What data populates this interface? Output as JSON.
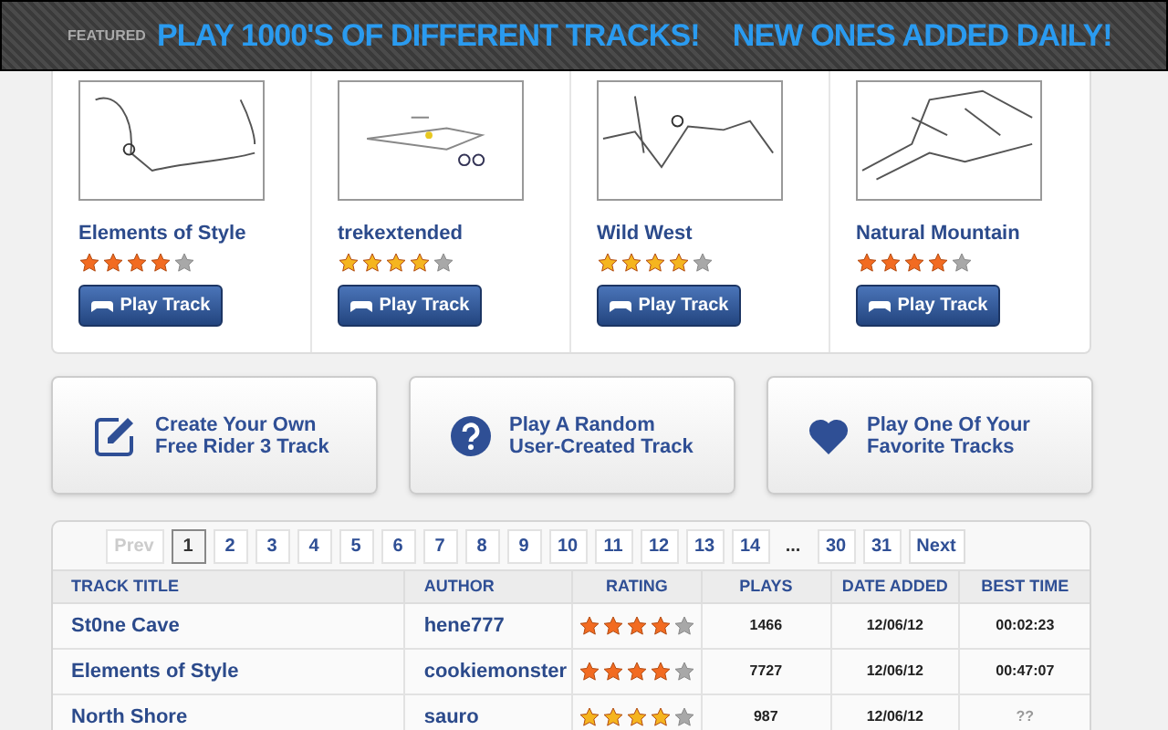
{
  "banner": {
    "label": "FEATURED",
    "headline": "PLAY 1000'S OF DIFFERENT TRACKS!",
    "tagline": "NEW ONES ADDED DAILY!"
  },
  "featured": [
    {
      "title": "Elements of Style",
      "stars": 4,
      "color": "#f26b21",
      "button": "Play Track"
    },
    {
      "title": "trekextended",
      "stars": 4,
      "color": "#f5b51f",
      "button": "Play Track"
    },
    {
      "title": "Wild West",
      "stars": 4,
      "color": "#f5b51f",
      "button": "Play Track"
    },
    {
      "title": "Natural Mountain",
      "stars": 4,
      "color": "#f26b21",
      "button": "Play Track"
    }
  ],
  "actions": [
    {
      "kind": "create",
      "lines": [
        "Create Your Own",
        "Free Rider 3 Track"
      ]
    },
    {
      "kind": "random",
      "lines": [
        "Play A Random",
        "User-Created Track"
      ]
    },
    {
      "kind": "favorite",
      "lines": [
        "Play One Of Your",
        "Favorite Tracks"
      ]
    }
  ],
  "pagination": {
    "prev": {
      "label": "Prev",
      "disabled": true
    },
    "pages": [
      {
        "label": "1",
        "selected": true
      },
      {
        "label": "2",
        "selected": false
      },
      {
        "label": "3",
        "selected": false
      },
      {
        "label": "4",
        "selected": false
      },
      {
        "label": "5",
        "selected": false
      },
      {
        "label": "6",
        "selected": false
      },
      {
        "label": "7",
        "selected": false
      },
      {
        "label": "8",
        "selected": false
      },
      {
        "label": "9",
        "selected": false
      },
      {
        "label": "10",
        "selected": false
      },
      {
        "label": "11",
        "selected": false
      },
      {
        "label": "12",
        "selected": false
      },
      {
        "label": "13",
        "selected": false
      },
      {
        "label": "14",
        "selected": false
      }
    ],
    "gap": "...",
    "end_pages": [
      {
        "label": "30",
        "selected": false
      },
      {
        "label": "31",
        "selected": false
      }
    ],
    "next": {
      "label": "Next",
      "disabled": false
    }
  },
  "table": {
    "columns": [
      "TRACK TITLE",
      "AUTHOR",
      "RATING",
      "PLAYS",
      "DATE ADDED",
      "BEST TIME"
    ],
    "rows": [
      {
        "title": "St0ne Cave",
        "author": "hene777",
        "stars": 4,
        "color": "#f26b21",
        "plays": "1466",
        "date": "12/06/12",
        "best_time": "00:02:23",
        "best_time_known": true
      },
      {
        "title": "Elements of Style",
        "author": "cookiemonster",
        "stars": 4,
        "color": "#f26b21",
        "plays": "7727",
        "date": "12/06/12",
        "best_time": "00:47:07",
        "best_time_known": true
      },
      {
        "title": "North Shore",
        "author": "sauro",
        "stars": 4,
        "color": "#f5b51f",
        "plays": "987",
        "date": "12/06/12",
        "best_time": "??",
        "best_time_known": false
      }
    ]
  }
}
